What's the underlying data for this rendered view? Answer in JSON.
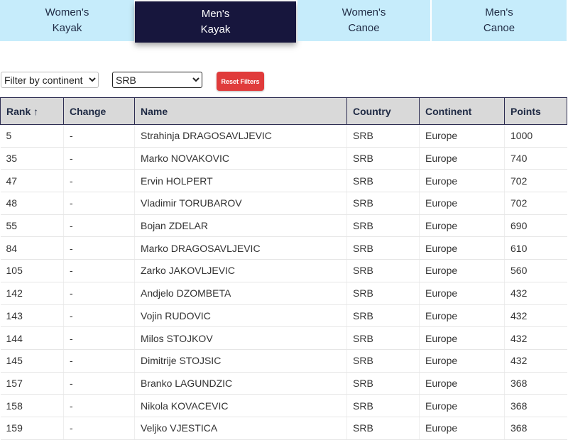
{
  "tabs": [
    {
      "line1": "Women's",
      "line2": "Kayak",
      "active": false
    },
    {
      "line1": "Men's",
      "line2": "Kayak",
      "active": true
    },
    {
      "line1": "Women's",
      "line2": "Canoe",
      "active": false
    },
    {
      "line1": "Men's",
      "line2": "Canoe",
      "active": false
    }
  ],
  "filters": {
    "continent_selected": "Filter by continent",
    "country_selected": "SRB",
    "reset_label": "Reset Filters"
  },
  "table": {
    "headers": [
      "Rank ↑",
      "Change",
      "Name",
      "Country",
      "Continent",
      "Points"
    ],
    "rows": [
      [
        "5",
        "-",
        "Strahinja DRAGOSAVLJEVIC",
        "SRB",
        "Europe",
        "1000"
      ],
      [
        "35",
        "-",
        "Marko NOVAKOVIC",
        "SRB",
        "Europe",
        "740"
      ],
      [
        "47",
        "-",
        "Ervin HOLPERT",
        "SRB",
        "Europe",
        "702"
      ],
      [
        "48",
        "-",
        "Vladimir TORUBAROV",
        "SRB",
        "Europe",
        "702"
      ],
      [
        "55",
        "-",
        "Bojan ZDELAR",
        "SRB",
        "Europe",
        "690"
      ],
      [
        "84",
        "-",
        "Marko DRAGOSAVLJEVIC",
        "SRB",
        "Europe",
        "610"
      ],
      [
        "105",
        "-",
        "Zarko JAKOVLJEVIC",
        "SRB",
        "Europe",
        "560"
      ],
      [
        "142",
        "-",
        "Andjelo DZOMBETA",
        "SRB",
        "Europe",
        "432"
      ],
      [
        "143",
        "-",
        "Vojin RUDOVIC",
        "SRB",
        "Europe",
        "432"
      ],
      [
        "144",
        "-",
        "Milos STOJKOV",
        "SRB",
        "Europe",
        "432"
      ],
      [
        "145",
        "-",
        "Dimitrije STOJSIC",
        "SRB",
        "Europe",
        "432"
      ],
      [
        "157",
        "-",
        "Branko LAGUNDZIC",
        "SRB",
        "Europe",
        "368"
      ],
      [
        "158",
        "-",
        "Nikola KOVACEVIC",
        "SRB",
        "Europe",
        "368"
      ],
      [
        "159",
        "-",
        "Veljko VJESTICA",
        "SRB",
        "Europe",
        "368"
      ]
    ]
  }
}
